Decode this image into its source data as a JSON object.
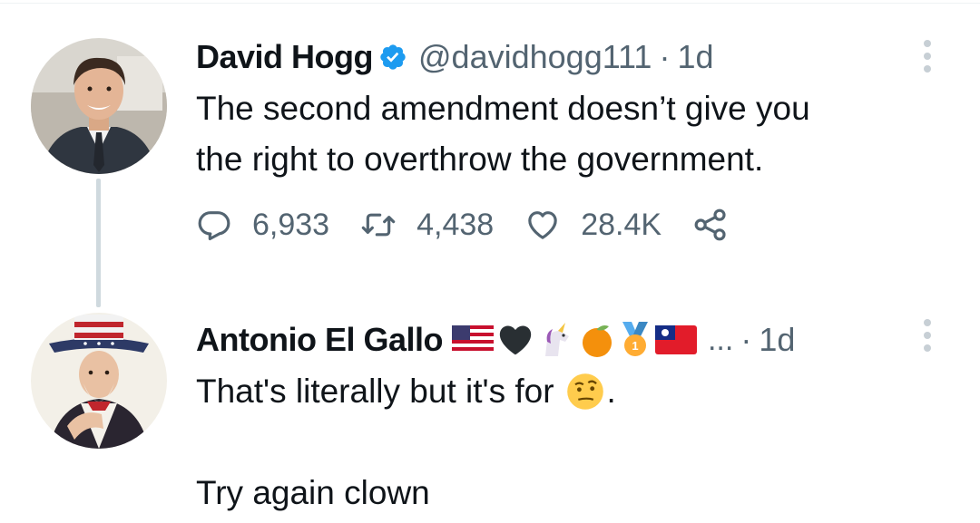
{
  "tweet": {
    "author_name": "David Hogg",
    "handle": "@davidhogg111",
    "separator": "·",
    "time": "1d",
    "text_line1": "The second amendment doesn’t give you",
    "text_line2": "the right to overthrow the government.",
    "reply_count": "6,933",
    "retweet_count": "4,438",
    "like_count": "28.4K",
    "icons": [
      "verified-badge-icon",
      "reply-icon",
      "retweet-icon",
      "like-icon",
      "share-icon",
      "more-icon"
    ]
  },
  "reply": {
    "author_name": "Antonio El Gallo",
    "name_emojis": [
      "us-flag-emoji",
      "black-heart-emoji",
      "unicorn-emoji",
      "tangerine-emoji",
      "first-place-medal-emoji",
      "taiwan-flag-emoji"
    ],
    "ellipsis": "...",
    "separator": "·",
    "time": "1d",
    "text_line1": "That's literally but it's for",
    "text_line1_end": ".",
    "text_emoji": "face-with-raised-eyebrow-emoji",
    "text_line2": "Try again clown"
  },
  "colors": {
    "text": "#0f1419",
    "secondary": "#536471",
    "verified": "#1d9bf0",
    "thread_line": "#cfd9de"
  }
}
